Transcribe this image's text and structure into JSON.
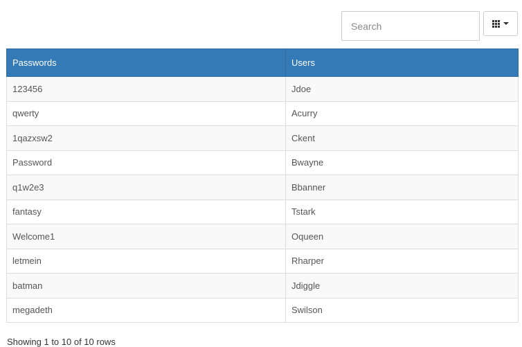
{
  "toolbar": {
    "search_placeholder": "Search",
    "columns_icon": "grid-icon",
    "dropdown_icon": "caret-down-icon"
  },
  "table": {
    "header_color": "#337ab7",
    "columns": [
      "Passwords",
      "Users"
    ],
    "rows": [
      [
        "123456",
        "Jdoe"
      ],
      [
        "qwerty",
        "Acurry"
      ],
      [
        "1qazxsw2",
        "Ckent"
      ],
      [
        "Password",
        "Bwayne"
      ],
      [
        "q1w2e3",
        "Bbanner"
      ],
      [
        "fantasy",
        "Tstark"
      ],
      [
        "Welcome1",
        "Oqueen"
      ],
      [
        "letmein",
        "Rharper"
      ],
      [
        "batman",
        "Jdiggle"
      ],
      [
        "megadeth",
        "Swilson"
      ]
    ]
  },
  "footer": {
    "pagination_info": "Showing 1 to 10 of 10 rows"
  }
}
